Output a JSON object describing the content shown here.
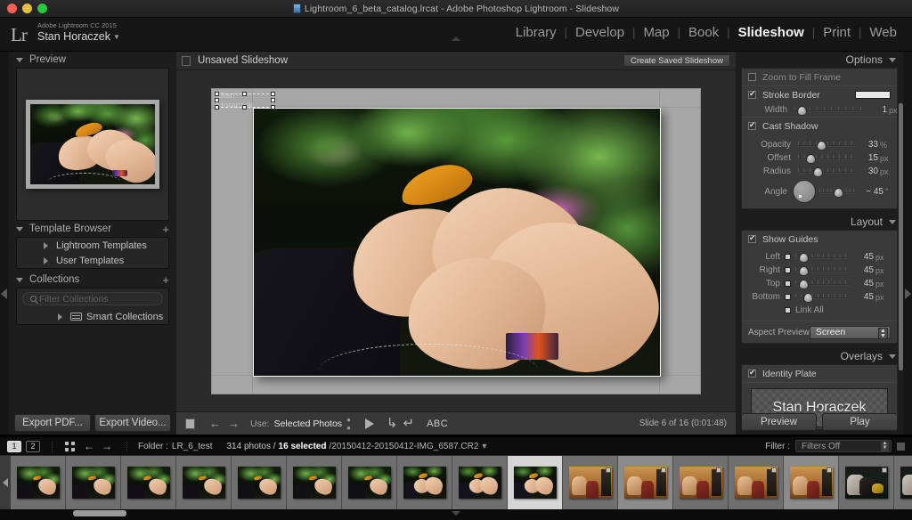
{
  "titlebar": {
    "title": "Lightroom_6_beta_catalog.lrcat - Adobe Photoshop Lightroom - Slideshow",
    "file_icon": "catalog-file-icon"
  },
  "identity": {
    "logo": "Lr",
    "line1": "Adobe Lightroom CC 2015",
    "name": "Stan Horaczek",
    "caret": "▼"
  },
  "modules": [
    {
      "label": "Library",
      "active": false
    },
    {
      "label": "Develop",
      "active": false
    },
    {
      "label": "Map",
      "active": false
    },
    {
      "label": "Book",
      "active": false
    },
    {
      "label": "Slideshow",
      "active": true
    },
    {
      "label": "Print",
      "active": false
    },
    {
      "label": "Web",
      "active": false
    }
  ],
  "left": {
    "preview": {
      "title": "Preview"
    },
    "template_browser": {
      "title": "Template Browser",
      "add": "+",
      "items": [
        "Lightroom Templates",
        "User Templates"
      ]
    },
    "collections": {
      "title": "Collections",
      "add": "+",
      "filter_placeholder": "Filter Collections",
      "items": [
        "Smart Collections"
      ]
    }
  },
  "center": {
    "header_title": "Unsaved Slideshow",
    "create_button": "Create Saved Slideshow",
    "overlay_text": "Stan Horaczek",
    "toolbar": {
      "use_label": "Use:",
      "use_value": "Selected Photos",
      "abc": "ABC",
      "status": "Slide 6 of 16 (0:01:48)"
    }
  },
  "right": {
    "options": {
      "title": "Options",
      "zoom_to_fill": {
        "label": "Zoom to Fill Frame",
        "checked": false
      },
      "stroke_border": {
        "label": "Stroke Border",
        "checked": true,
        "color": "#e8e8e8"
      },
      "width": {
        "label": "Width",
        "value": "1",
        "unit": "px",
        "pct": 8
      },
      "cast_shadow": {
        "label": "Cast Shadow",
        "checked": true
      },
      "sliders": [
        {
          "label": "Opacity",
          "value": "33",
          "unit": "%",
          "pct": 36
        },
        {
          "label": "Offset",
          "value": "15",
          "unit": "px",
          "pct": 18
        },
        {
          "label": "Radius",
          "value": "30",
          "unit": "px",
          "pct": 30
        },
        {
          "label": "Angle",
          "value": "− 45",
          "unit": "°",
          "pct": 40
        }
      ]
    },
    "layout": {
      "title": "Layout",
      "show_guides": {
        "label": "Show Guides",
        "checked": true
      },
      "margins": [
        {
          "label": "Left",
          "value": "45",
          "unit": "px",
          "pct": 10
        },
        {
          "label": "Right",
          "value": "45",
          "unit": "px",
          "pct": 10
        },
        {
          "label": "Top",
          "value": "45",
          "unit": "px",
          "pct": 10
        },
        {
          "label": "Bottom",
          "value": "45",
          "unit": "px",
          "pct": 18
        }
      ],
      "link_all": {
        "label": "Link All",
        "checked": false
      },
      "aspect_preview": {
        "label": "Aspect Preview",
        "value": "Screen"
      }
    },
    "overlays": {
      "title": "Overlays",
      "identity_plate": {
        "label": "Identity Plate",
        "checked": true,
        "text": "Stan Horaczek"
      }
    },
    "buttons": {
      "preview": "Preview",
      "play": "Play"
    }
  },
  "bottom_toolbar": {
    "export_pdf": "Export PDF...",
    "export_video": "Export Video..."
  },
  "filmstrip_header": {
    "screen1": "1",
    "screen2": "2",
    "folder_label": "Folder :",
    "folder_name": "LR_6_test",
    "photo_count": "314 photos /",
    "selected_count": "16 selected",
    "file_path": "/20150412-20150412-IMG_6587.CR2",
    "caret": "▾",
    "filter_label": "Filter :",
    "filter_value": "Filters Off"
  },
  "filmstrip": {
    "thumbs": [
      {
        "scene": "garden",
        "state": "normal",
        "badge": false
      },
      {
        "scene": "garden",
        "state": "normal",
        "badge": false
      },
      {
        "scene": "garden",
        "state": "normal",
        "badge": false
      },
      {
        "scene": "garden",
        "state": "normal",
        "badge": false
      },
      {
        "scene": "garden",
        "state": "normal",
        "badge": false
      },
      {
        "scene": "garden",
        "state": "normal",
        "badge": false
      },
      {
        "scene": "garden",
        "state": "normal",
        "badge": false
      },
      {
        "scene": "hands",
        "state": "normal",
        "badge": false
      },
      {
        "scene": "hands",
        "state": "normal",
        "badge": false
      },
      {
        "scene": "hands",
        "state": "selected",
        "badge": false
      },
      {
        "scene": "indoor",
        "state": "normal",
        "badge": true
      },
      {
        "scene": "indoor",
        "state": "semi",
        "badge": true
      },
      {
        "scene": "indoor",
        "state": "normal",
        "badge": true
      },
      {
        "scene": "indoor",
        "state": "normal",
        "badge": true
      },
      {
        "scene": "indoor",
        "state": "semi",
        "badge": true
      },
      {
        "scene": "stage",
        "state": "normal",
        "badge": true
      },
      {
        "scene": "stage",
        "state": "normal",
        "badge": true
      },
      {
        "scene": "stage",
        "state": "normal",
        "badge": true
      },
      {
        "scene": "stage",
        "state": "normal",
        "badge": false
      }
    ]
  }
}
